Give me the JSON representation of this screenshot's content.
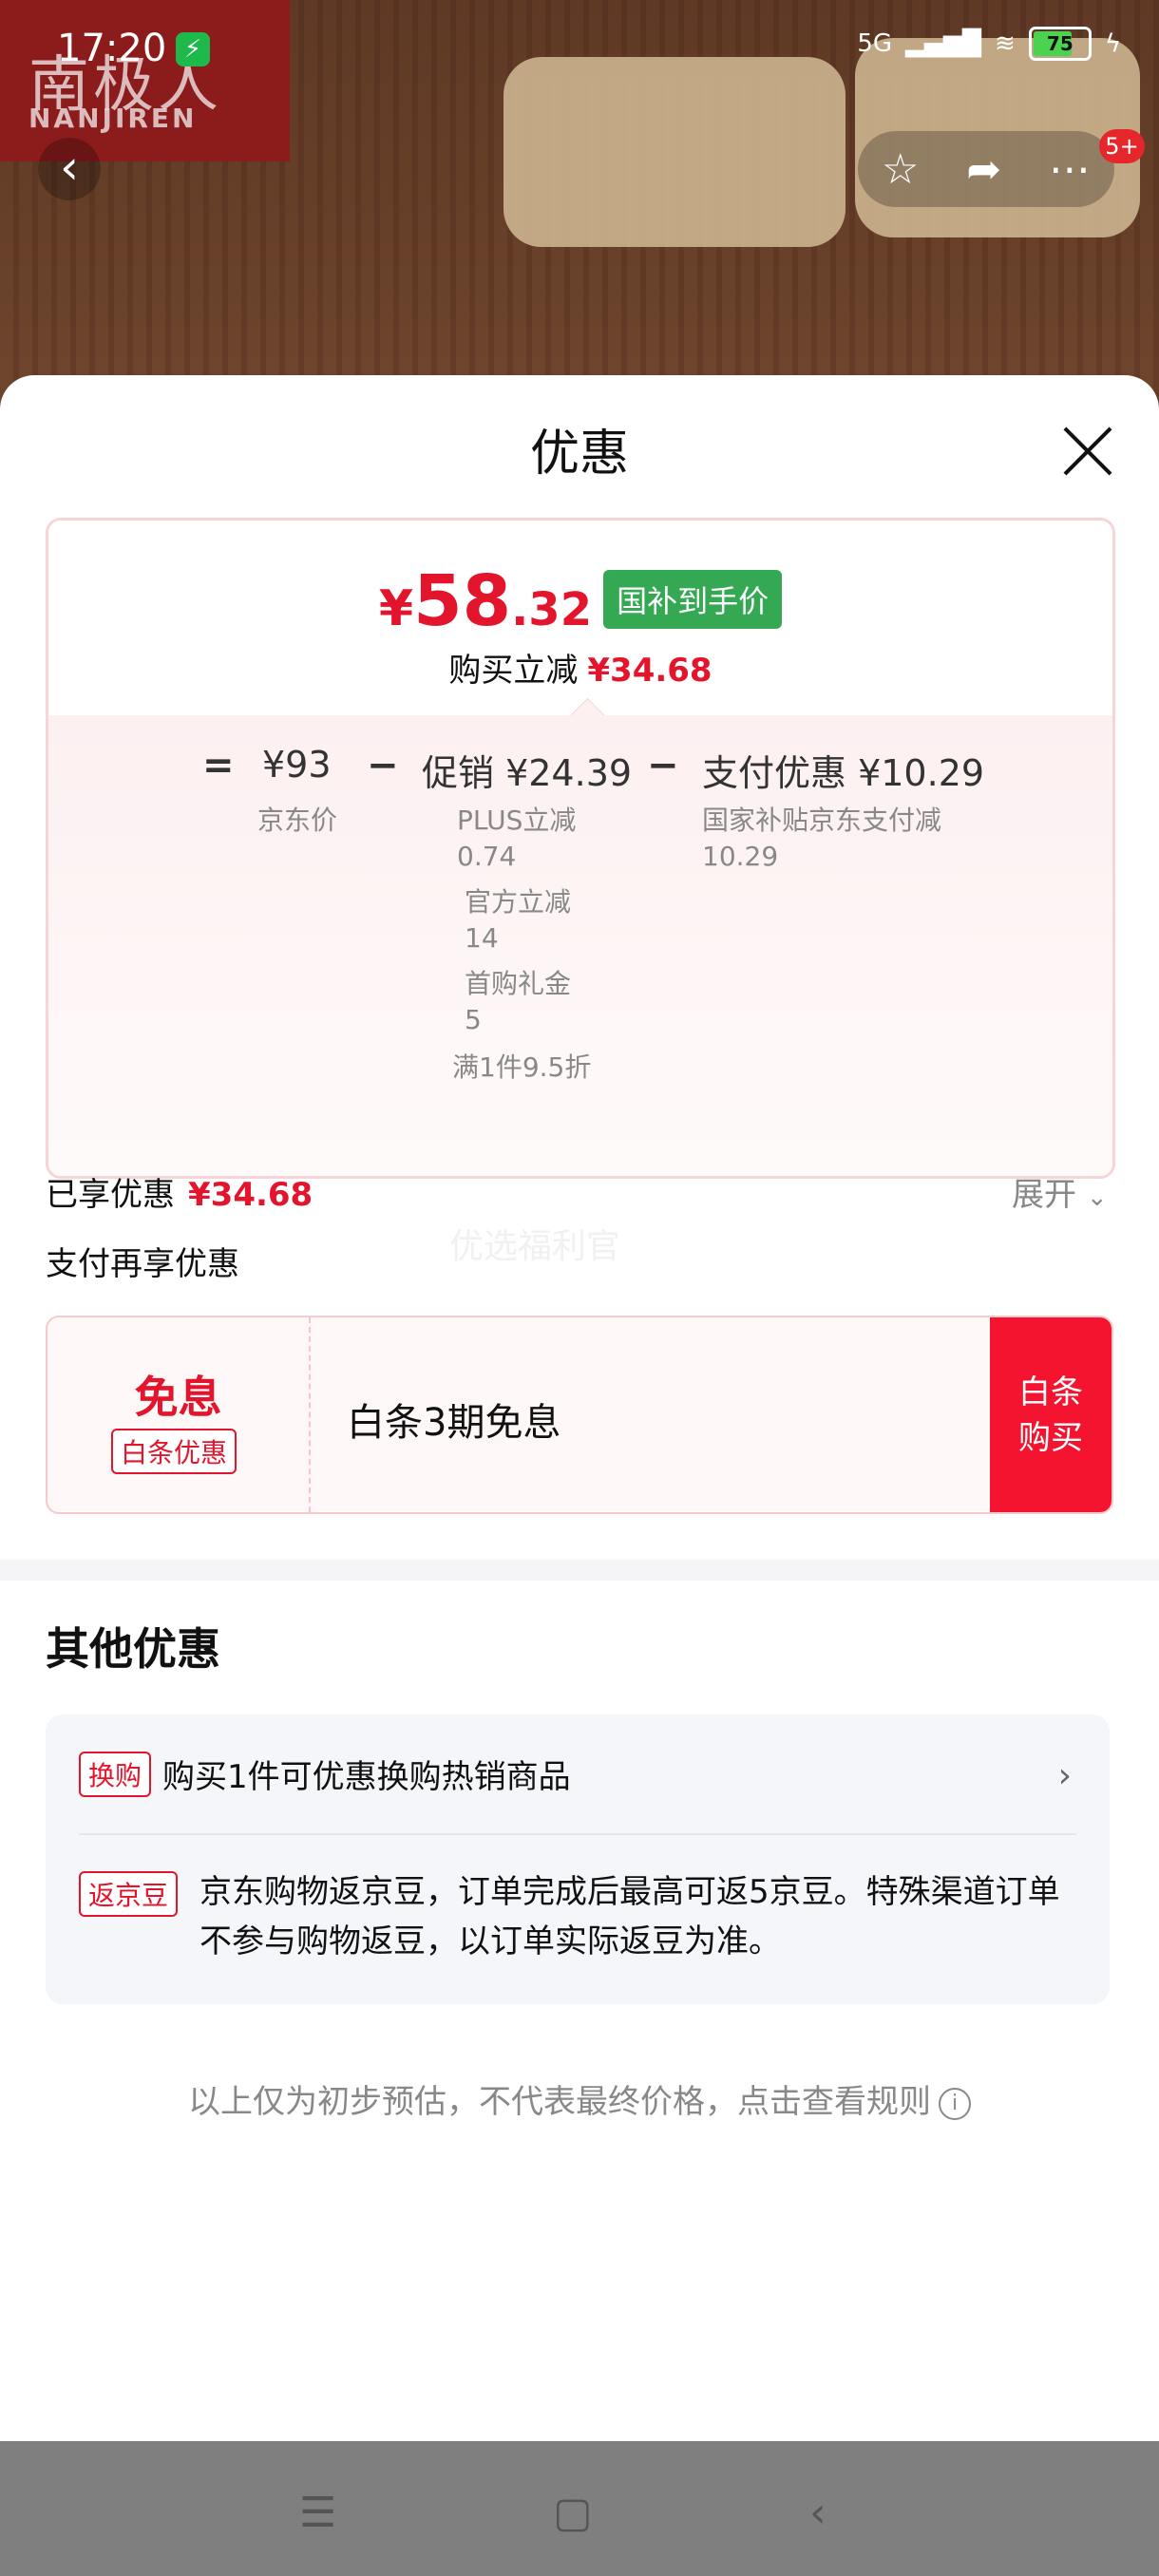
{
  "status_bar": {
    "time": "17:20",
    "network": "5G",
    "battery": "75"
  },
  "header": {
    "logo_cn": "南极人",
    "logo_en": "NANJIREN",
    "back_icon": "chevron-left-icon",
    "actions": [
      "star-icon",
      "share-icon",
      "more-icon"
    ],
    "badge": "5+"
  },
  "sheet": {
    "title": "优惠",
    "price": {
      "yen": "¥",
      "int": "58",
      "dec": ".32",
      "tag": "国补到手价",
      "buy_reduce_label": "购买立减",
      "buy_reduce_amount": "¥34.68"
    },
    "formula": {
      "eq": "=",
      "jd_price": "¥93",
      "jd_price_label": "京东价",
      "minus1": "−",
      "promo": "促销 ¥24.39",
      "promo_items": [
        {
          "name": "PLUS立减",
          "value": "0.74"
        },
        {
          "name": "官方立减",
          "value": "14"
        },
        {
          "name": "首购礼金",
          "value": "5"
        }
      ],
      "promo_rule": "满1件9.5折",
      "minus2": "−",
      "pay": "支付优惠 ¥10.29",
      "pay_items": [
        {
          "name": "国家补贴京东支付减",
          "value": "10.29"
        }
      ]
    },
    "enjoyed_label": "已享优惠",
    "enjoyed_amount": "¥34.68",
    "expand_label": "展开",
    "pay_more_label": "支付再享优惠",
    "watermark": "优选福利官",
    "baitiao": {
      "title": "免息",
      "tag": "白条优惠",
      "desc": "白条3期免息",
      "buy_line1": "白条",
      "buy_line2": "购买"
    },
    "other": {
      "title": "其他优惠",
      "row1": {
        "tag": "换购",
        "text": "购买1件可优惠换购热销商品"
      },
      "row2": {
        "tag": "返京豆",
        "text": "京东购物返京豆，订单完成后最高可返5京豆。特殊渠道订单不参与购物返豆，以订单实际返豆为准。"
      }
    },
    "note": "以上仅为初步预估，不代表最终价格，点击查看规则"
  },
  "nav": [
    "menu-icon",
    "home-icon",
    "back-icon"
  ]
}
